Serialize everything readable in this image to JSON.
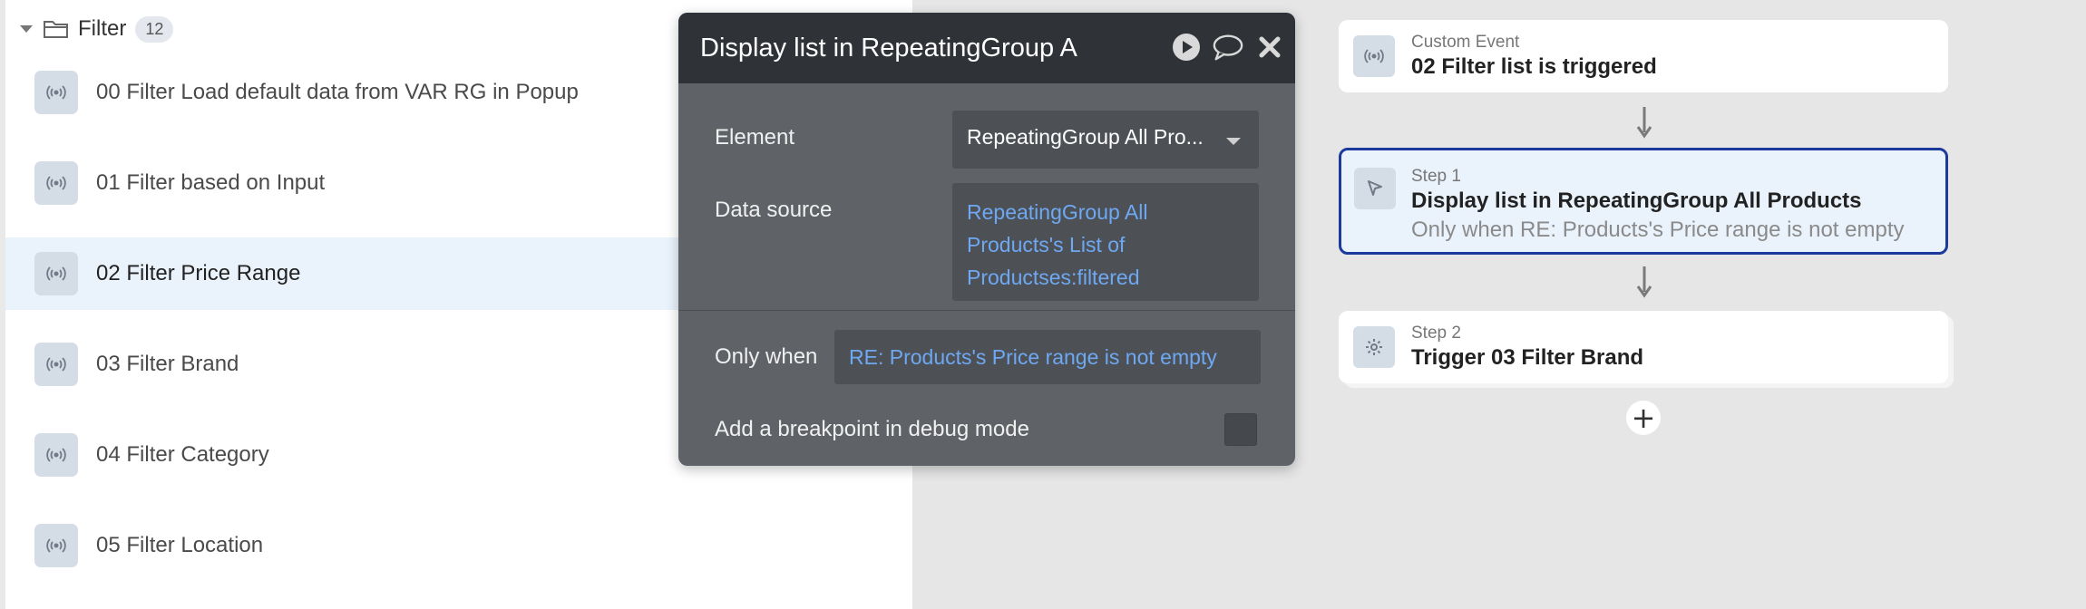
{
  "folder": {
    "label": "Filter",
    "count": "12"
  },
  "events": [
    {
      "label": "00 Filter Load default data from VAR RG in Popup",
      "icon": "broadcast-icon"
    },
    {
      "label": "01 Filter based on Input",
      "icon": "broadcast-icon"
    },
    {
      "label": "02 Filter Price Range",
      "icon": "broadcast-icon",
      "selected": true
    },
    {
      "label": "03 Filter Brand",
      "icon": "broadcast-icon"
    },
    {
      "label": "04 Filter Category",
      "icon": "broadcast-icon"
    },
    {
      "label": "05 Filter Location",
      "icon": "broadcast-icon"
    }
  ],
  "popup": {
    "title": "Display list in RepeatingGroup A",
    "header_icons": [
      "play-icon",
      "comment-icon",
      "close-icon"
    ],
    "element_label": "Element",
    "element_value": "RepeatingGroup All Pro...",
    "data_source_label": "Data source",
    "data_source_value": "RepeatingGroup All Products's List of Productses:filtered",
    "only_when_label": "Only when",
    "only_when_value": "RE: Products's Price range is not empty",
    "breakpoint_label": "Add a breakpoint in debug mode"
  },
  "workflow": {
    "trigger": {
      "kicker": "Custom Event",
      "title": "02 Filter list is triggered",
      "icon": "broadcast-icon"
    },
    "steps": [
      {
        "kicker": "Step 1",
        "title": "Display list in RepeatingGroup All Products",
        "condition": "Only when RE: Products's Price range is not empty",
        "icon": "cursor-icon",
        "selected": true
      },
      {
        "kicker": "Step 2",
        "title": "Trigger 03 Filter Brand",
        "icon": "gear-icon"
      }
    ],
    "add_step_icon": "plus-icon"
  },
  "colors": {
    "selected_bg": "#eaf2fc",
    "selected_border": "#1b3a9b",
    "dynamic_text": "#6fa8f2",
    "popup_bg": "#5f6368",
    "popup_header": "#2f3337"
  }
}
